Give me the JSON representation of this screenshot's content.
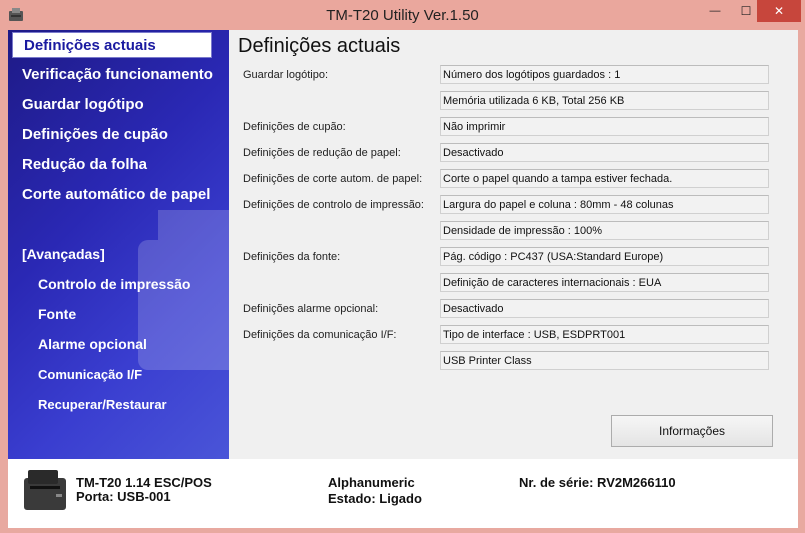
{
  "window": {
    "title": "TM-T20 Utility Ver.1.50"
  },
  "titlebar_buttons": {
    "minimize": "—",
    "maximize": "☐",
    "close": "✕"
  },
  "sidebar": {
    "items": [
      "Definições actuais",
      "Verificação funcionamento",
      "Guardar logótipo",
      "Definições de cupão",
      "Redução da folha",
      "Corte automático de papel"
    ],
    "advanced_header": "[Avançadas]",
    "advanced_items": [
      "Controlo de impressão",
      "Fonte",
      "Alarme opcional",
      "Comunicação I/F",
      "Recuperar/Restaurar"
    ]
  },
  "main": {
    "heading": "Definições actuais",
    "labels": [
      "Guardar logótipo:",
      "Definições de cupão:",
      "Definições de redução de papel:",
      "Definições de corte autom. de papel:",
      "Definições de controlo de impressão:",
      "Definições da fonte:",
      "Definições alarme opcional:",
      "Definições da comunicação I/F:"
    ],
    "values": [
      "Número dos logótipos guardados : 1",
      "Memória utilizada 6 KB, Total 256 KB",
      "Não imprimir",
      "Desactivado",
      "Corte o papel quando a tampa estiver fechada.",
      "Largura do papel e coluna : 80mm - 48 colunas",
      "Densidade de impressão : 100%",
      "Pág. código : PC437 (USA:Standard Europe)",
      "Definição de caracteres internacionais : EUA",
      "Desactivado",
      "Tipo de interface : USB, ESDPRT001",
      "USB Printer Class"
    ],
    "info_button": "Informações"
  },
  "status": {
    "model": "TM-T20 1.14 ESC/POS",
    "port": "Porta: USB-001",
    "charset": "Alphanumeric",
    "state": "Estado: Ligado",
    "serial": "Nr. de série: RV2M266110"
  }
}
